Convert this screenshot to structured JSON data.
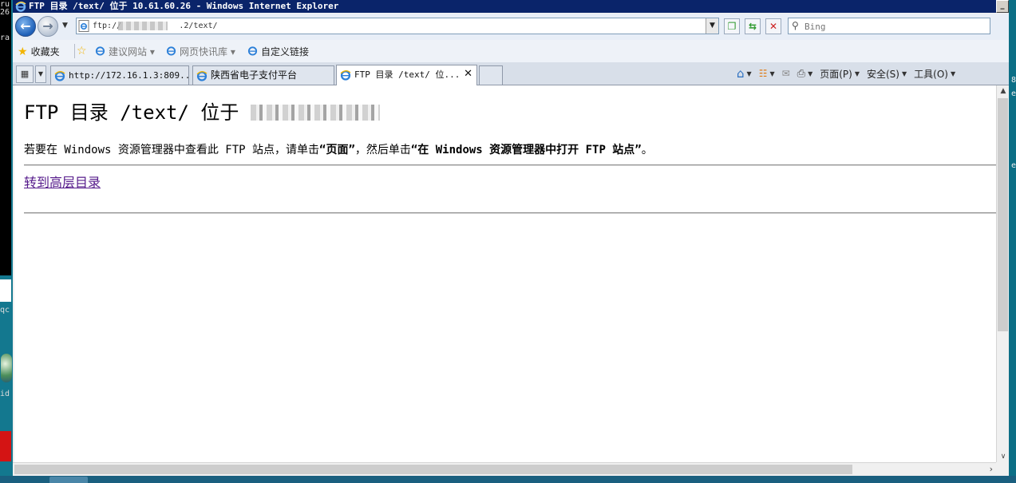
{
  "window": {
    "title": "FTP 目录 /text/ 位于 10.61.60.26 - Windows Internet Explorer",
    "minimize_label": "_"
  },
  "address": {
    "url": "ftp://            .2/text/",
    "dropdown": "▼"
  },
  "search": {
    "placeholder": "Bing"
  },
  "favorites": {
    "label": "收藏夹",
    "items": [
      {
        "label": "建议网站 ▾"
      },
      {
        "label": "网页快讯库 ▾"
      },
      {
        "label": "自定义链接"
      }
    ]
  },
  "tabs": [
    {
      "label": "http://172.16.1.3:809..."
    },
    {
      "label": "陕西省电子支付平台"
    },
    {
      "label": "FTP 目录 /text/ 位..."
    }
  ],
  "commandbar": {
    "page": "页面(P)",
    "safety": "安全(S)",
    "tools": "工具(O)"
  },
  "content": {
    "heading_prefix": "FTP 目录 /text/ 位于",
    "instruction_prefix": "若要在 Windows 资源管理器中查看此 FTP 站点，请单击",
    "instruction_bold1": "“页面”",
    "instruction_mid": "，然后单击",
    "instruction_bold2": "“在 Windows 资源管理器中打开 FTP 站点”",
    "instruction_suffix": "。",
    "up_link": "转到高层目录"
  },
  "desktop": {
    "left_texts": [
      "ru",
      "26",
      "ra",
      "qc",
      "id"
    ],
    "right_texts": [
      "8",
      "e",
      "e"
    ]
  },
  "colors": {
    "titlebar": "#0a246a",
    "visited_link": "#551a8b",
    "desktop": "#0f6e86"
  }
}
